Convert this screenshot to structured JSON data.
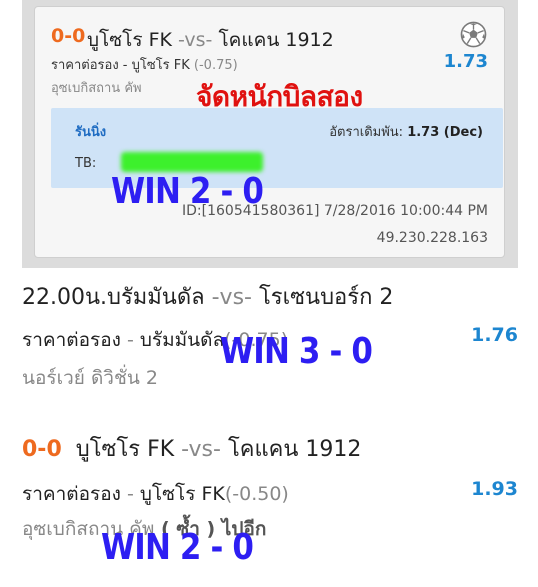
{
  "bet_slip": {
    "score": "0-0",
    "home": "บูโซโร FK",
    "vs": "-vs-",
    "away": "โคแคน 1912",
    "odds_label": "ราคาต่อรอง - บูโซโร FK",
    "handicap": "(-0.75)",
    "odds": "1.73",
    "league": "อุซเบกิสถาน คัพ",
    "stamp_text": "จัดหนักบิลสอง",
    "status": "รันนิ่ง",
    "bet_rate_label": "อัตราเดิมพัน:",
    "bet_rate_value": "1.73 (Dec)",
    "tb_label": "TB:",
    "meta_id": "ID:[160541580361] 7/28/2016 10:00:44 PM",
    "meta_ip": "49.230.228.163"
  },
  "overlays": {
    "win1": "WIN 2 - 0",
    "win2": "WIN 3 - 0",
    "win3": "WIN 2 - 0"
  },
  "matches": [
    {
      "title_prefix": "22.00น.",
      "home": "บรัมมันดัล",
      "vs": "-vs-",
      "away": "โรเซนบอร์ก 2",
      "odds_label": "ราคาต่อรอง",
      "sep": " - ",
      "pick": "บรัมมันดัล",
      "handicap": "(-0.75)",
      "odds": "1.76",
      "league": "นอร์เวย์ ดิวิชั่น 2",
      "note": ""
    },
    {
      "title_prefix": "0-0",
      "home": "บูโซโร FK",
      "vs": "-vs-",
      "away": "โคแคน 1912",
      "odds_label": "ราคาต่อรอง",
      "sep": " - ",
      "pick": "บูโซโร FK",
      "handicap": "(-0.50)",
      "odds": "1.93",
      "league": "อุซเบกิสถาน คัพ",
      "note": " ( ซ้ำ ) ไปอีก"
    }
  ],
  "colors": {
    "score": "#ee6a1f",
    "odds": "#1d86d0",
    "stamp": "#e0110f",
    "win_overlay": "#2d1ef2",
    "ticket_bg": "#cfe3f7",
    "censor": "#3df02c"
  },
  "icons": [
    "soccer-ball-icon"
  ]
}
